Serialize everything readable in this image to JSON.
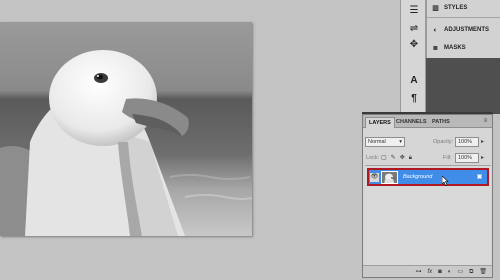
{
  "canvas": {
    "subject_icon": "seagull-photo"
  },
  "icon_column": {
    "icons": [
      "styles-icon",
      "adjustments-icon",
      "tool-preset-icon",
      "character-icon",
      "paragraph-icon"
    ]
  },
  "panels": [
    {
      "label": "STYLES",
      "icon": "styles-icon"
    },
    {
      "label": "ADJUSTMENTS",
      "icon": "adjustments-icon"
    },
    {
      "label": "MASKS",
      "icon": "masks-icon"
    }
  ],
  "layers_panel": {
    "tabs": [
      "LAYERS",
      "CHANNELS",
      "PATHS"
    ],
    "active_tab": "LAYERS",
    "blend_mode": "Normal",
    "opacity_label": "Opacity:",
    "opacity_value": "100%",
    "lock_label": "Lock:",
    "fill_label": "Fill:",
    "fill_value": "100%",
    "layers": [
      {
        "name": "Background",
        "selected": true,
        "visible": true,
        "locked": true
      }
    ],
    "highlight_color": "#3f8de8",
    "outline_color": "#b01922"
  }
}
